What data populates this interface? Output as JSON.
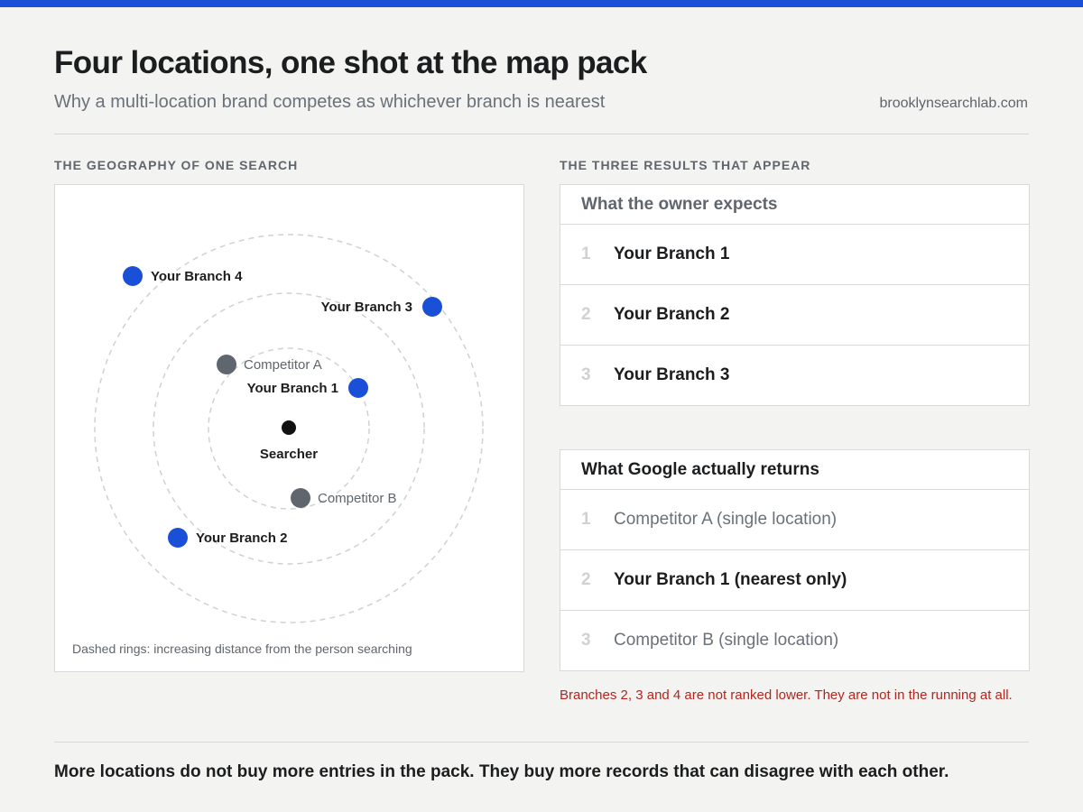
{
  "header": {
    "title": "Four locations, one shot at the map pack",
    "subtitle": "Why a multi-location brand competes as whichever branch is nearest",
    "site": "brooklynsearchlab.com"
  },
  "map": {
    "section_label": "THE GEOGRAPHY OF ONE SEARCH",
    "note": "Dashed rings: increasing distance from the person searching",
    "searcher_label": "Searcher",
    "points": [
      {
        "id": "branch-4",
        "label": "Your Branch 4",
        "kind": "own"
      },
      {
        "id": "branch-3",
        "label": "Your Branch 3",
        "kind": "own"
      },
      {
        "id": "competitor-a",
        "label": "Competitor A",
        "kind": "competitor"
      },
      {
        "id": "branch-1",
        "label": "Your Branch 1",
        "kind": "own"
      },
      {
        "id": "competitor-b",
        "label": "Competitor B",
        "kind": "competitor"
      },
      {
        "id": "branch-2",
        "label": "Your Branch 2",
        "kind": "own"
      }
    ]
  },
  "results": {
    "section_label": "THE THREE RESULTS THAT APPEAR",
    "expected": {
      "title": "What the owner expects",
      "rows": [
        {
          "rank": "1",
          "name": "Your Branch 1",
          "kind": "own"
        },
        {
          "rank": "2",
          "name": "Your Branch 2",
          "kind": "own"
        },
        {
          "rank": "3",
          "name": "Your Branch 3",
          "kind": "own"
        }
      ]
    },
    "actual": {
      "title": "What Google actually returns",
      "rows": [
        {
          "rank": "1",
          "name": "Competitor A  (single location)",
          "kind": "competitor"
        },
        {
          "rank": "2",
          "name": "Your Branch 1  (nearest only)",
          "kind": "own"
        },
        {
          "rank": "3",
          "name": "Competitor B  (single location)",
          "kind": "competitor"
        }
      ]
    },
    "warning": "Branches 2, 3 and 4 are not ranked lower. They are not in the running at all."
  },
  "footer": {
    "takeaway": "More locations do not buy more entries in the pack. They buy more records that can disagree with each other."
  },
  "colors": {
    "accent": "#1a4fd8",
    "own": "#1a4fd8",
    "competitor": "#5f666d",
    "searcher": "#111111",
    "warning": "#b3261e"
  }
}
